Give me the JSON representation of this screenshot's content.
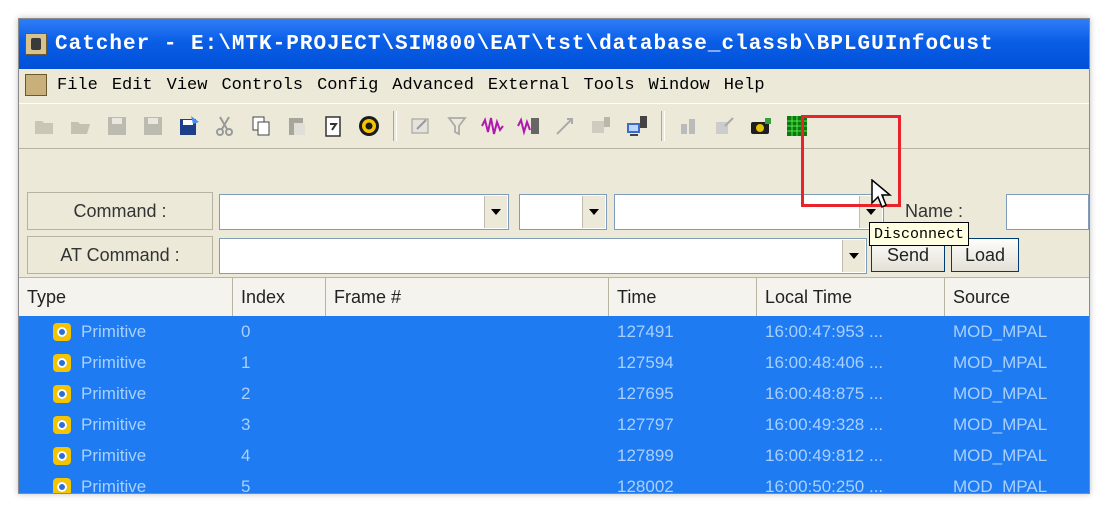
{
  "window": {
    "title": "Catcher - E:\\MTK-PROJECT\\SIM800\\EAT\\tst\\database_classb\\BPLGUInfoCust"
  },
  "menu": [
    "File",
    "Edit",
    "View",
    "Controls",
    "Config",
    "Advanced",
    "External",
    "Tools",
    "Window",
    "Help"
  ],
  "toolbar": {
    "icons": [
      "open-icon",
      "open-folder-icon",
      "save-icon",
      "save-all-icon",
      "save-filter-icon",
      "cut-icon",
      "copy-icon",
      "paste-icon",
      "clipboard-icon",
      "target-icon",
      "edit-icon",
      "filter-icon",
      "waveform-icon",
      "waveform-connect-icon",
      "pointer-icon",
      "connect-icon",
      "disconnect-icon",
      "stats-icon",
      "export-icon",
      "camera-icon",
      "grid-icon"
    ]
  },
  "command_row": {
    "label": "Command :",
    "name_label": "Name :"
  },
  "at_row": {
    "label": "AT Command :",
    "send_label": "Send",
    "load_label": "Load"
  },
  "tooltip": {
    "text": "Disconnect"
  },
  "table": {
    "columns": [
      "Type",
      "Index",
      "Frame #",
      "Time",
      "Local Time",
      "Source"
    ],
    "rows": [
      {
        "type": "Primitive",
        "index": "0",
        "frame": "",
        "time": "127491",
        "local": "16:00:47:953 ...",
        "source": "MOD_MPAL"
      },
      {
        "type": "Primitive",
        "index": "1",
        "frame": "",
        "time": "127594",
        "local": "16:00:48:406 ...",
        "source": "MOD_MPAL"
      },
      {
        "type": "Primitive",
        "index": "2",
        "frame": "",
        "time": "127695",
        "local": "16:00:48:875 ...",
        "source": "MOD_MPAL"
      },
      {
        "type": "Primitive",
        "index": "3",
        "frame": "",
        "time": "127797",
        "local": "16:00:49:328 ...",
        "source": "MOD_MPAL"
      },
      {
        "type": "Primitive",
        "index": "4",
        "frame": "",
        "time": "127899",
        "local": "16:00:49:812 ...",
        "source": "MOD_MPAL"
      },
      {
        "type": "Primitive",
        "index": "5",
        "frame": "",
        "time": "128002",
        "local": "16:00:50:250 ...",
        "source": "MOD_MPAL"
      }
    ]
  },
  "colors": {
    "titlebar": "#0a5ee6",
    "selection": "#1e7bf2",
    "highlight": "#e8232b",
    "tooltip_bg": "#ffffe1"
  }
}
